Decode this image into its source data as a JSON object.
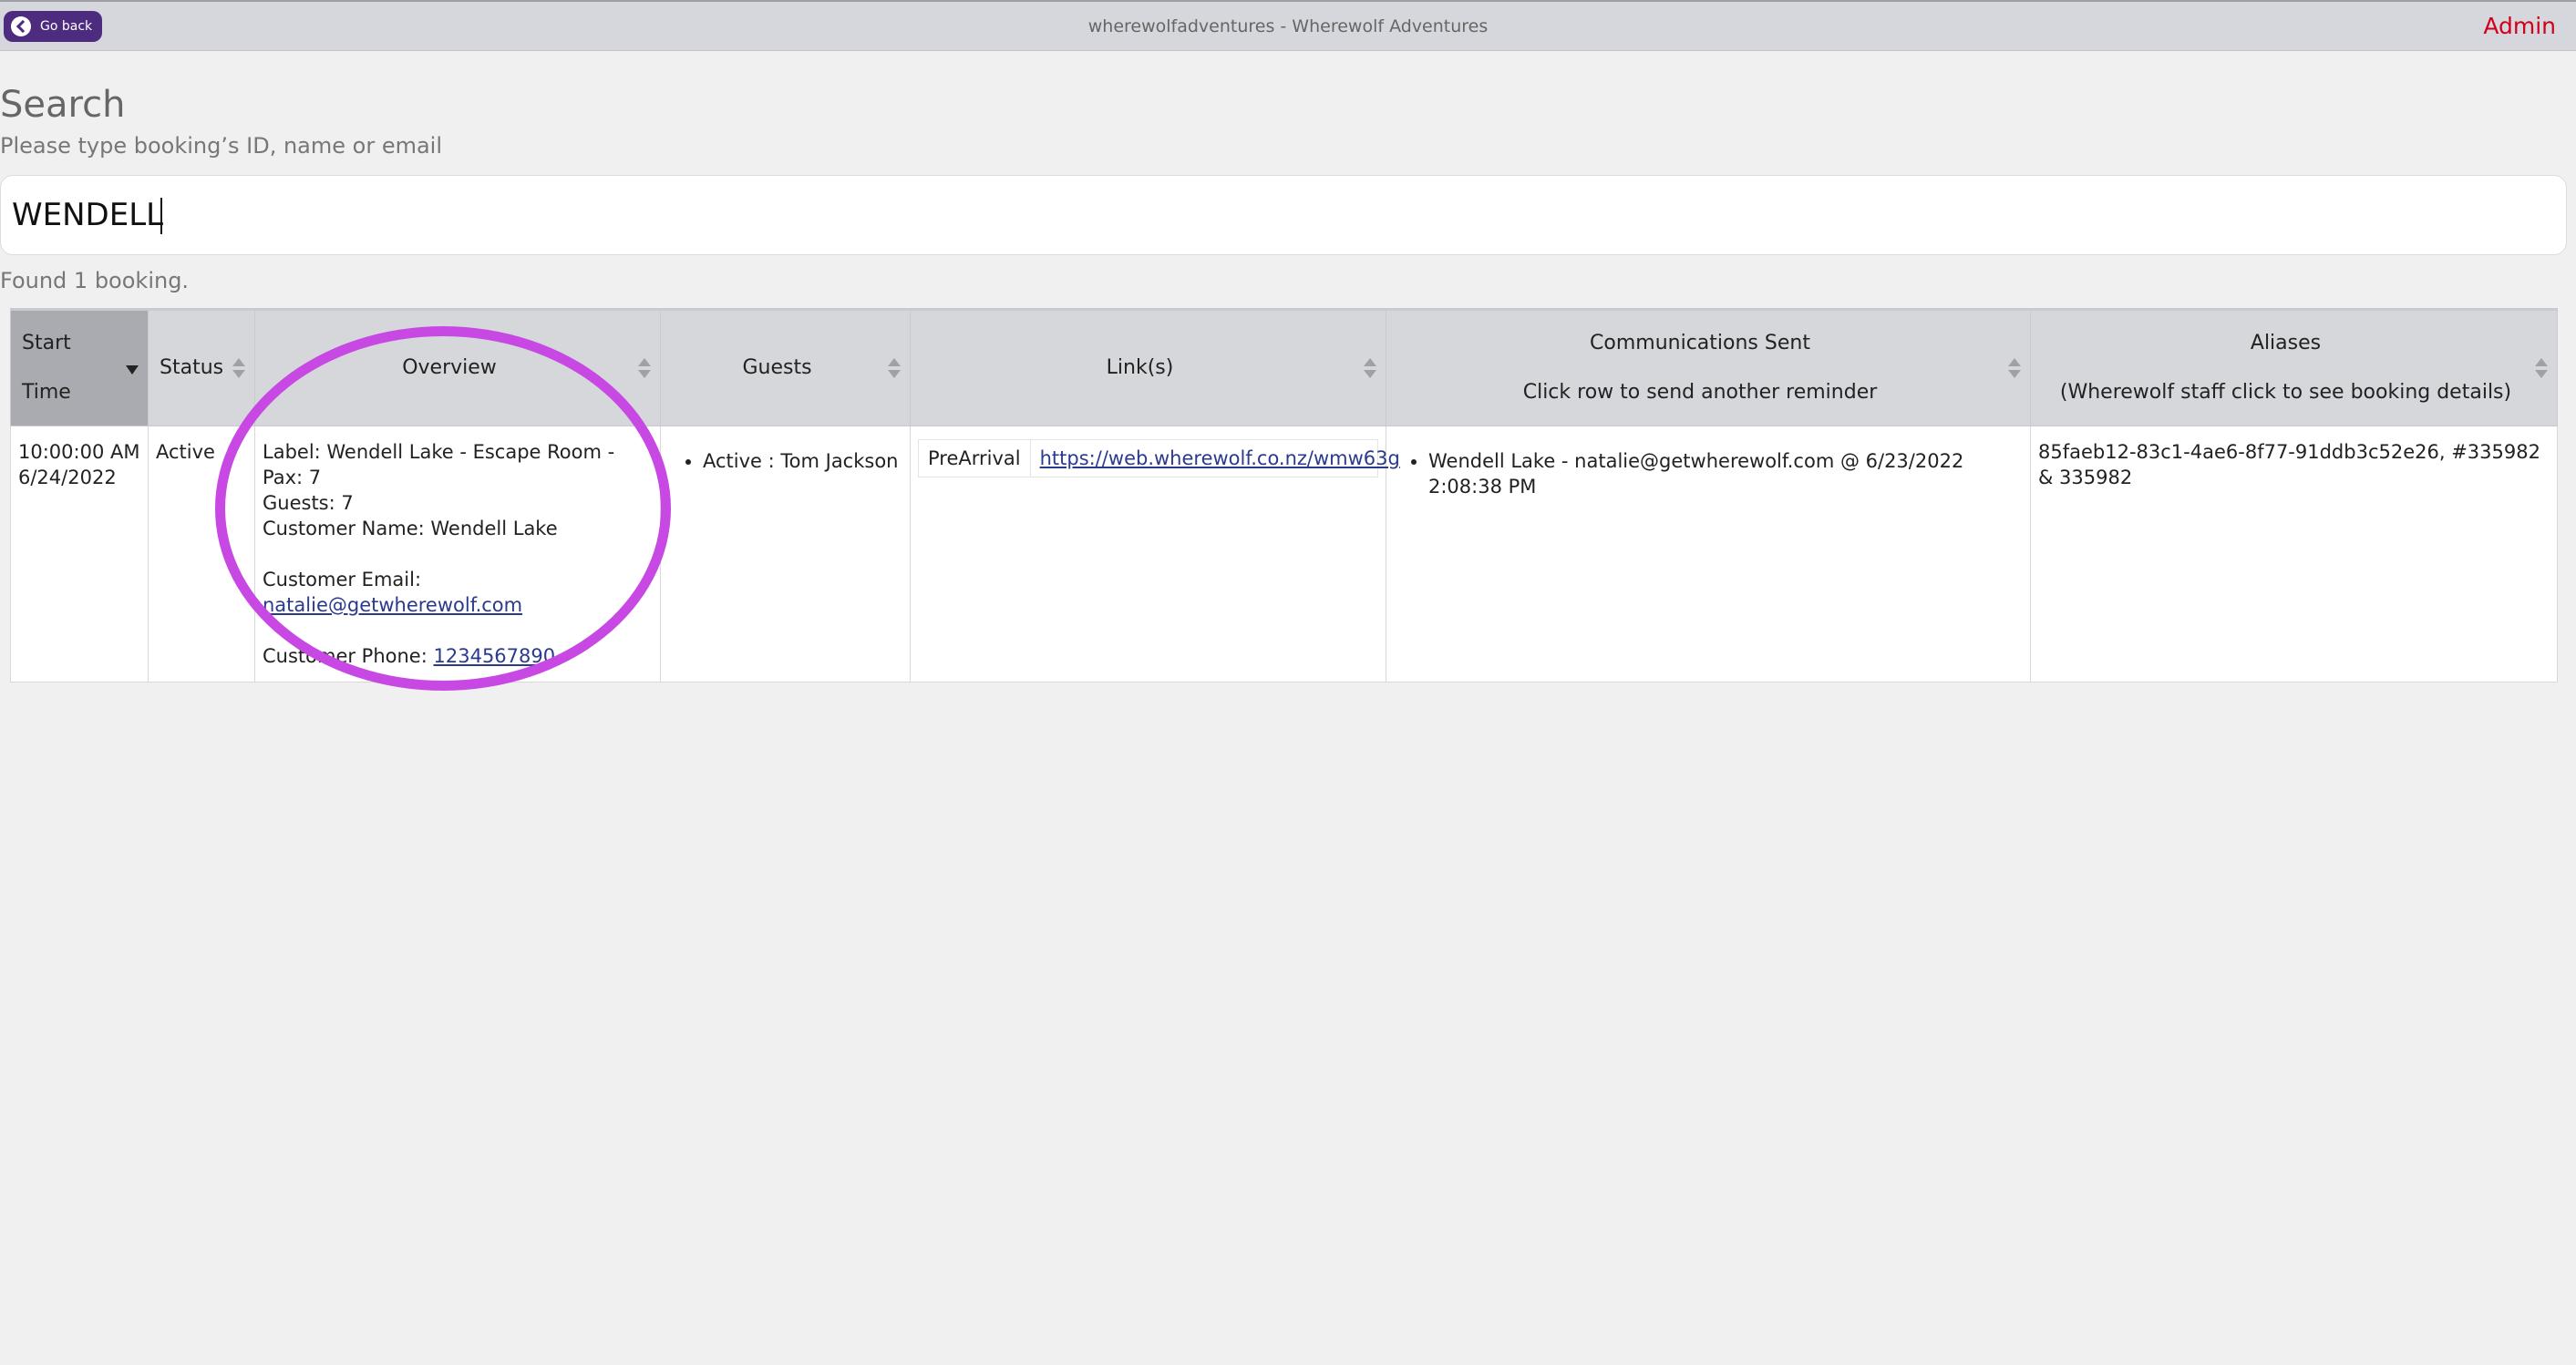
{
  "header": {
    "back_label": "Go back",
    "title": "wherewolfadventures - Wherewolf Adventures",
    "admin_label": "Admin"
  },
  "search": {
    "heading": "Search",
    "subheading": "Please type booking’s ID, name or email",
    "value": "WENDELL",
    "result_count": "Found 1 booking."
  },
  "table": {
    "headers": {
      "start_time": "Start Time",
      "status": "Status",
      "overview": "Overview",
      "guests": "Guests",
      "links": "Link(s)",
      "comms_title": "Communications Sent",
      "comms_sub": "Click row to send another reminder",
      "aliases_title": "Aliases",
      "aliases_sub": "(Wherewolf staff click to see booking details)"
    },
    "rows": [
      {
        "start_time_line1": "10:00:00 AM",
        "start_time_line2": "6/24/2022",
        "status": "Active",
        "overview": {
          "label": "Label: Wendell Lake - Escape Room - Pax: 7",
          "guests": "Guests: 7",
          "customer_name": "Customer Name: Wendell Lake",
          "email_label": "Customer Email:",
          "email": "natalie@getwherewolf.com",
          "phone_label": "Customer Phone:",
          "phone": "1234567890"
        },
        "guest": "Active : Tom Jackson",
        "link_type": "PreArrival",
        "link_url": "https://web.wherewolf.co.nz/wmw63g",
        "communication": "Wendell Lake - natalie@getwherewolf.com @ 6/23/2022 2:08:38 PM",
        "aliases": "85faeb12-83c1-4ae6-8f77-91ddb3c52e26, #335982 & 335982"
      }
    ]
  },
  "annotation": {
    "ring_color": "#c848e4"
  }
}
